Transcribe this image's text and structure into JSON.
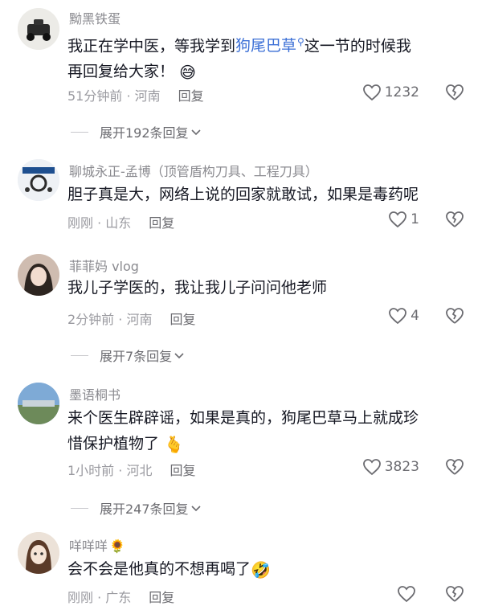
{
  "comments": [
    {
      "username": "黝黑铁蛋",
      "text_before": "我正在学中医，等我学到",
      "link_text": "狗尾巴草",
      "search_mark": "Q",
      "text_after": "这一节的时候我",
      "line2": "再回复给大家！",
      "emoji": "😅",
      "time": "51分钟前 · 河南",
      "reply": "回复",
      "likes": "1232"
    },
    {
      "username": "聊城永正-孟博（顶管盾构刀具、工程刀具）",
      "text": "胆子真是大，网络上说的回家就敢试，如果是毒药呢",
      "time": "刚刚 · 山东",
      "reply": "回复",
      "likes": "1"
    },
    {
      "username": "菲菲妈 vlog",
      "text": "我儿子学医的，我让我儿子问问他老师",
      "time": "2分钟前 · 河南",
      "reply": "回复",
      "likes": "4"
    },
    {
      "username": "墨语桐书",
      "line1": "来个医生辟辟谣，如果是真的，狗尾巴草马上就成珍",
      "line2": "惜保护植物了",
      "emoji": "🫰",
      "time": "1小时前 · 河北",
      "reply": "回复",
      "likes": "3823"
    },
    {
      "username": "咩咩咩",
      "flower": "🌻",
      "text": "会不会是他真的不想再喝了",
      "emoji": "🤣",
      "time": "刚刚 · 广东",
      "reply": "回复",
      "likes": ""
    }
  ],
  "expand": [
    "展开192条回复",
    "展开7条回复",
    "展开247条回复"
  ]
}
